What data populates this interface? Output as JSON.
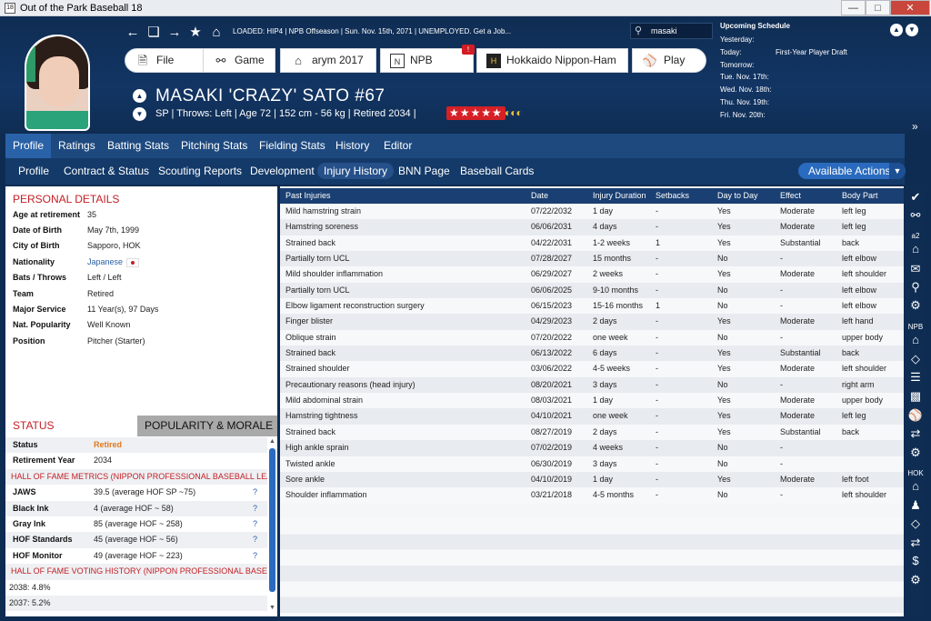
{
  "window": {
    "title": "Out of the Park Baseball 18",
    "app_icon": "18",
    "minimize": "—",
    "maximize": "□",
    "close": "✕"
  },
  "topbar": {
    "loaded_text": "LOADED: HIP4  |  NPB Offseason  |  Sun. Nov. 15th, 2071  |  UNEMPLOYED. Get a Job...",
    "search_value": "masaki"
  },
  "menu": {
    "file": "File",
    "game": "Game",
    "arym": "arym 2017",
    "npb": "NPB",
    "npb_badge": "!",
    "team": "Hokkaido Nippon-Ham",
    "play": "Play"
  },
  "player": {
    "name": "MASAKI 'CRAZY' SATO  #67",
    "details": "SP | Throws: Left  |  Age 72  |  152 cm - 56 kg  |  Retired 2034  |",
    "stars": "★★★★★",
    "half_stars": "◐◐◐"
  },
  "schedule": {
    "title": "Upcoming Schedule",
    "rows": [
      {
        "day": "Yesterday:",
        "event": ""
      },
      {
        "day": "Today:",
        "event": "First-Year Player Draft"
      },
      {
        "day": "Tomorrow:",
        "event": ""
      },
      {
        "day": "Tue. Nov. 17th:",
        "event": ""
      },
      {
        "day": "Wed. Nov. 18th:",
        "event": ""
      },
      {
        "day": "Thu. Nov. 19th:",
        "event": ""
      },
      {
        "day": "Fri. Nov. 20th:",
        "event": ""
      }
    ]
  },
  "tabs_primary": [
    "Profile",
    "Ratings",
    "Batting Stats",
    "Pitching Stats",
    "Fielding Stats",
    "History",
    "Editor"
  ],
  "tabs_secondary": [
    "Profile",
    "Contract & Status",
    "Scouting Reports",
    "Development",
    "Injury History",
    "BNN Page",
    "Baseball Cards"
  ],
  "available_actions": "Available Actions",
  "personal_details": {
    "title": "PERSONAL DETAILS",
    "rows": [
      {
        "k": "Age at retirement",
        "v": "35"
      },
      {
        "k": "Date of Birth",
        "v": "May 7th, 1999"
      },
      {
        "k": "City of Birth",
        "v": "Sapporo, HOK"
      },
      {
        "k": "Nationality",
        "v": "Japanese"
      },
      {
        "k": "Bats / Throws",
        "v": "Left / Left"
      },
      {
        "k": "Team",
        "v": "Retired"
      },
      {
        "k": "Major Service",
        "v": "11 Year(s), 97 Days"
      },
      {
        "k": "Nat. Popularity",
        "v": "Well Known"
      },
      {
        "k": "Position",
        "v": "Pitcher (Starter)"
      }
    ]
  },
  "status": {
    "tab_status": "STATUS",
    "tab_popularity": "POPULARITY & MORALE",
    "status_label": "Status",
    "status_value": "Retired",
    "retire_label": "Retirement Year",
    "retire_value": "2034",
    "hof_metrics_title": "HALL OF FAME METRICS (NIPPON PROFESSIONAL BASEBALL LEA",
    "metrics": [
      {
        "k": "JAWS",
        "v": "39.5 (average HOF SP ~75)",
        "q": "?"
      },
      {
        "k": "Black Ink",
        "v": "4 (average HOF ~ 58)",
        "q": "?"
      },
      {
        "k": "Gray Ink",
        "v": "85 (average HOF ~ 258)",
        "q": "?"
      },
      {
        "k": "HOF Standards",
        "v": "45 (average HOF ~ 56)",
        "q": "?"
      },
      {
        "k": "HOF Monitor",
        "v": "49 (average HOF ~ 223)",
        "q": "?"
      }
    ],
    "hof_voting_title": "HALL OF FAME VOTING HISTORY (NIPPON PROFESSIONAL BASEB",
    "votes": [
      "2038: 4.8%",
      "2037: 5.2%"
    ]
  },
  "injuries": {
    "columns": [
      "Past Injuries",
      "Date",
      "Injury Duration",
      "Setbacks",
      "Day to Day",
      "Effect",
      "Body Part"
    ],
    "rows": [
      [
        "Mild hamstring strain",
        "07/22/2032",
        "1 day",
        "-",
        "Yes",
        "Moderate",
        "left leg"
      ],
      [
        "Hamstring soreness",
        "06/06/2031",
        "4 days",
        "-",
        "Yes",
        "Moderate",
        "left leg"
      ],
      [
        "Strained back",
        "04/22/2031",
        "1-2 weeks",
        "1",
        "Yes",
        "Substantial",
        "back"
      ],
      [
        "Partially torn UCL",
        "07/28/2027",
        "15 months",
        "-",
        "No",
        "-",
        "left elbow"
      ],
      [
        "Mild shoulder inflammation",
        "06/29/2027",
        "2 weeks",
        "-",
        "Yes",
        "Moderate",
        "left shoulder"
      ],
      [
        "Partially torn UCL",
        "06/06/2025",
        "9-10 months",
        "-",
        "No",
        "-",
        "left elbow"
      ],
      [
        "Elbow ligament reconstruction surgery",
        "06/15/2023",
        "15-16 months",
        "1",
        "No",
        "-",
        "left elbow"
      ],
      [
        "Finger blister",
        "04/29/2023",
        "2 days",
        "-",
        "Yes",
        "Moderate",
        "left hand"
      ],
      [
        "Oblique strain",
        "07/20/2022",
        "one week",
        "-",
        "No",
        "-",
        "upper body"
      ],
      [
        "Strained back",
        "06/13/2022",
        "6 days",
        "-",
        "Yes",
        "Substantial",
        "back"
      ],
      [
        "Strained shoulder",
        "03/06/2022",
        "4-5 weeks",
        "-",
        "Yes",
        "Moderate",
        "left shoulder"
      ],
      [
        "Precautionary reasons (head injury)",
        "08/20/2021",
        "3 days",
        "-",
        "No",
        "-",
        "right arm"
      ],
      [
        "Mild abdominal strain",
        "08/03/2021",
        "1 day",
        "-",
        "Yes",
        "Moderate",
        "upper body"
      ],
      [
        "Hamstring tightness",
        "04/10/2021",
        "one week",
        "-",
        "Yes",
        "Moderate",
        "left leg"
      ],
      [
        "Strained back",
        "08/27/2019",
        "2 days",
        "-",
        "Yes",
        "Substantial",
        "back"
      ],
      [
        "High ankle sprain",
        "07/02/2019",
        "4 weeks",
        "-",
        "No",
        "-",
        ""
      ],
      [
        "Twisted ankle",
        "06/30/2019",
        "3 days",
        "-",
        "No",
        "-",
        ""
      ],
      [
        "Sore ankle",
        "04/10/2019",
        "1 day",
        "-",
        "Yes",
        "Moderate",
        "left foot"
      ],
      [
        "Shoulder inflammation",
        "03/21/2018",
        "4-5 months",
        "-",
        "No",
        "-",
        "left shoulder"
      ]
    ]
  },
  "rail": {
    "label_a2": "a2",
    "label_npb": "NPB",
    "label_hok": "HOK"
  }
}
